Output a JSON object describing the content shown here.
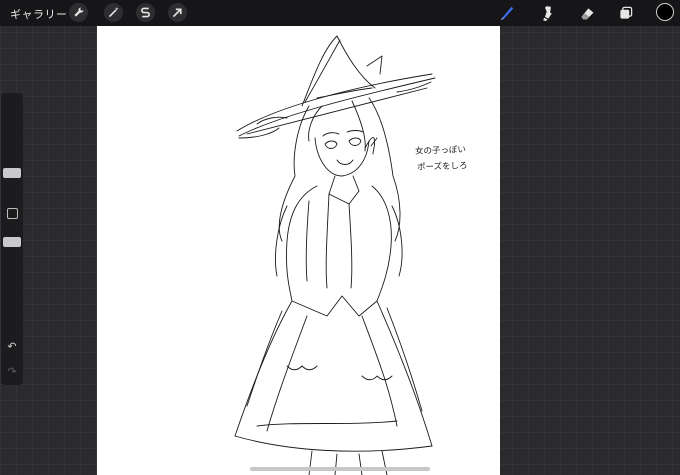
{
  "topbar": {
    "gallery_label": "ギャラリー",
    "left_tools": [
      {
        "name": "wrench-icon"
      },
      {
        "name": "magic-wand-icon"
      },
      {
        "name": "selection-icon"
      },
      {
        "name": "transform-arrow-icon"
      }
    ],
    "right_tools": [
      {
        "name": "brush-icon",
        "active": true,
        "color": "#3a6cf0"
      },
      {
        "name": "smudge-icon"
      },
      {
        "name": "eraser-icon"
      },
      {
        "name": "layers-icon"
      }
    ],
    "current_color": "#000000"
  },
  "canvas": {
    "note_line1": "女の子っぽい",
    "note_line2": "ポーズをしろ"
  }
}
